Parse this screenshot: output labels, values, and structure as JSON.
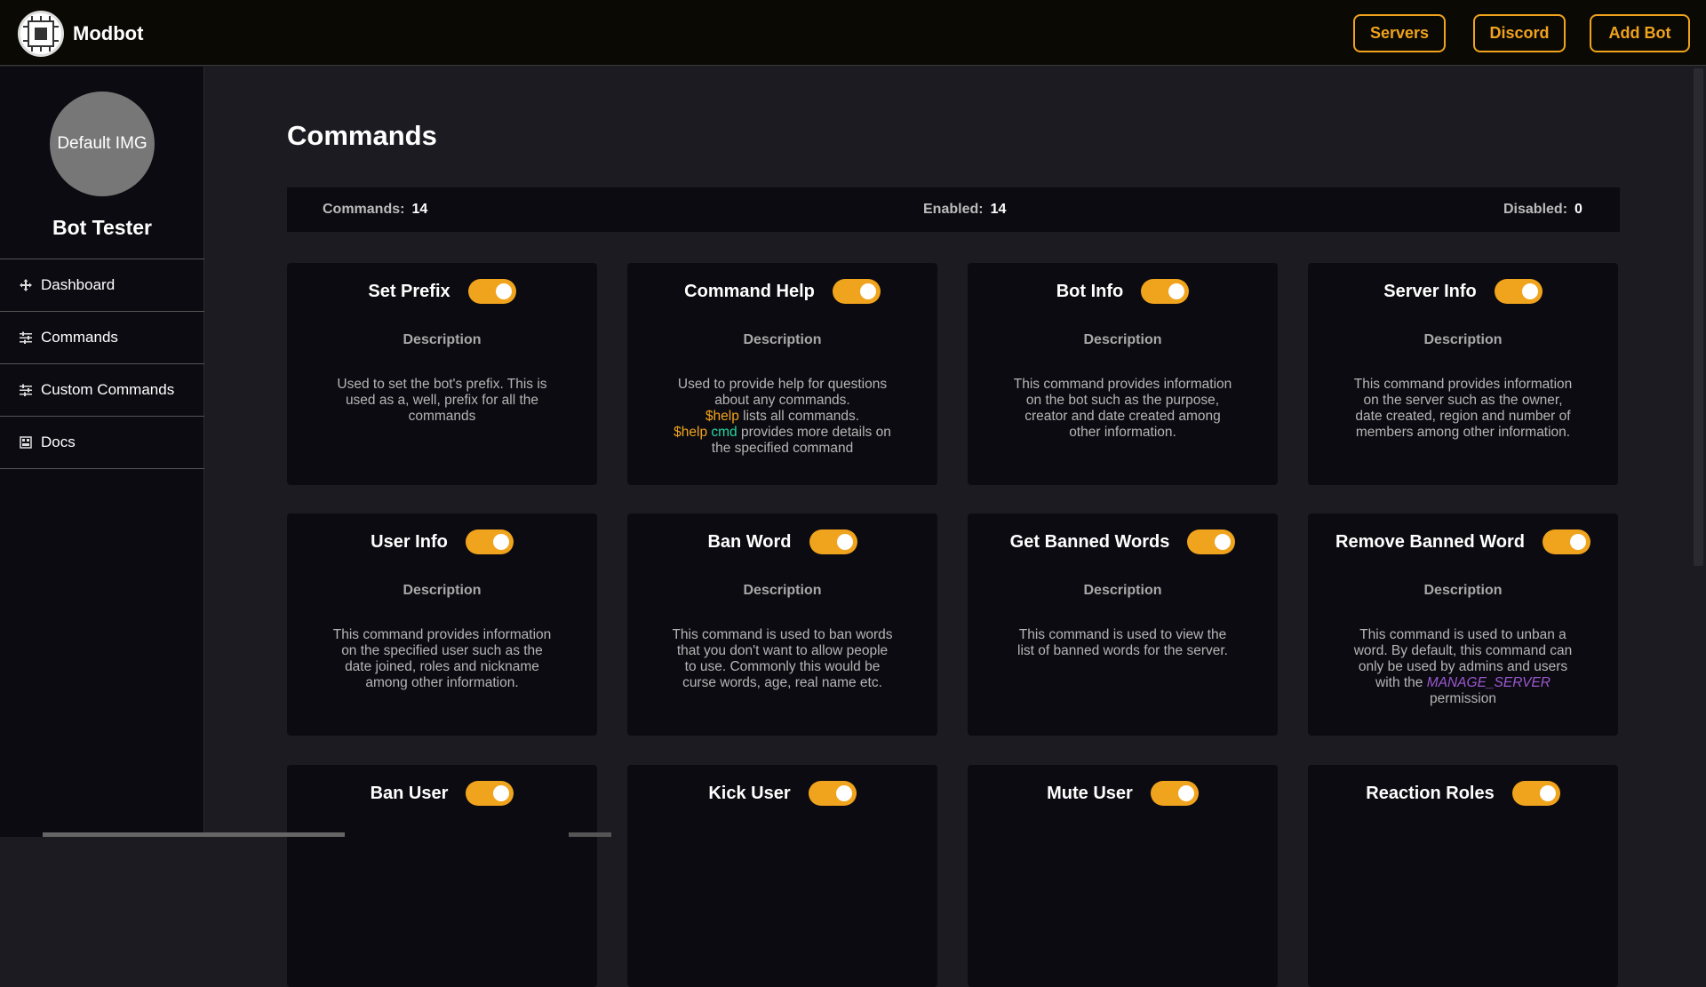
{
  "header": {
    "brand": "Modbot",
    "buttons": [
      "Servers",
      "Discord",
      "Add Bot"
    ]
  },
  "sidebar": {
    "avatar_text": "Default IMG",
    "bot_name": "Bot Tester",
    "items": [
      {
        "label": "Dashboard",
        "icon": "move-icon"
      },
      {
        "label": "Commands",
        "icon": "sliders-icon"
      },
      {
        "label": "Custom Commands",
        "icon": "sliders-icon"
      },
      {
        "label": "Docs",
        "icon": "grid-icon"
      }
    ]
  },
  "main": {
    "title": "Commands",
    "stats": {
      "commands_label": "Commands:",
      "commands_value": "14",
      "enabled_label": "Enabled:",
      "enabled_value": "14",
      "disabled_label": "Disabled:",
      "disabled_value": "0"
    },
    "desc_heading": "Description",
    "cards": [
      {
        "title": "Set Prefix",
        "desc": "Used to set the bot's prefix. This is used as a, well, prefix for all the commands",
        "enabled": true
      },
      {
        "title": "Command Help",
        "desc_a": "Used to provide help for questions about any commands.",
        "help1": "$help",
        "desc_b": " lists all commands.",
        "help2": "$help",
        "cmd": "cmd",
        "desc_c": " provides more details on the specified command",
        "enabled": true
      },
      {
        "title": "Bot Info",
        "desc": "This command provides information on the bot such as the purpose, creator and date created among other information.",
        "enabled": true
      },
      {
        "title": "Server Info",
        "desc": "This command provides information on the server such as the owner, date created, region and number of members among other information.",
        "enabled": true
      },
      {
        "title": "User Info",
        "desc": "This command provides information on the specified user such as the date joined, roles and nickname among other information.",
        "enabled": true
      },
      {
        "title": "Ban Word",
        "desc": "This command is used to ban words that you don't want to allow people to use. Commonly this would be curse words, age, real name etc.",
        "enabled": true
      },
      {
        "title": "Get Banned Words",
        "desc": "This command is used to view the list of banned words for the server.",
        "enabled": true
      },
      {
        "title": "Remove Banned Word",
        "desc_a": "This command is used to unban a word. By default, this command can only be used by admins and users with the ",
        "perm": "MANAGE_SERVER",
        "desc_b": " permission",
        "enabled": true
      },
      {
        "title": "Ban User",
        "enabled": true
      },
      {
        "title": "Kick User",
        "enabled": true
      },
      {
        "title": "Mute User",
        "enabled": true
      },
      {
        "title": "Reaction Roles",
        "enabled": true
      }
    ]
  },
  "colors": {
    "accent": "#f0a31c",
    "background": "#1c1b22",
    "panel": "#0c0b11",
    "topbar": "#0b0904"
  }
}
